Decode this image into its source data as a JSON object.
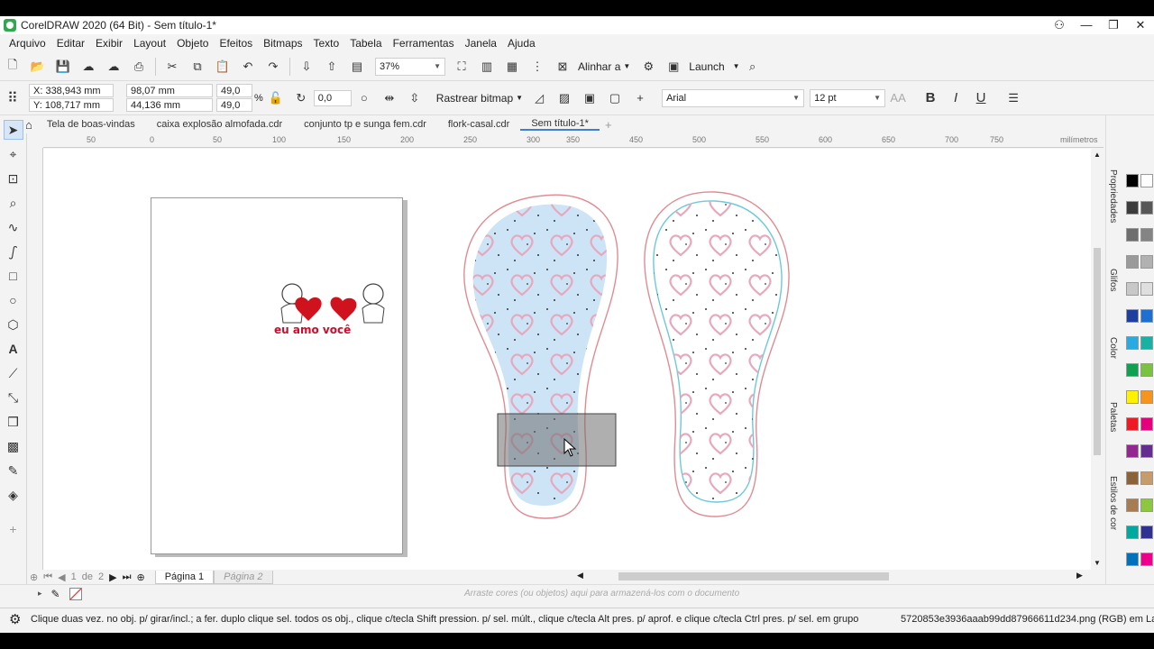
{
  "window": {
    "title": "CorelDRAW 2020 (64 Bit) - Sem título-1*"
  },
  "menu": [
    "Arquivo",
    "Editar",
    "Exibir",
    "Layout",
    "Objeto",
    "Efeitos",
    "Bitmaps",
    "Texto",
    "Tabela",
    "Ferramentas",
    "Janela",
    "Ajuda"
  ],
  "toolbar1": {
    "zoom": "37%",
    "align_label": "Alinhar a",
    "launch_label": "Launch"
  },
  "toolbar2": {
    "x": "X: 338,943 mm",
    "y": "Y: 108,717 mm",
    "w": "98,07 mm",
    "h": "44,136 mm",
    "scale_x": "49,0",
    "scale_y": "49,0",
    "pct": "%",
    "rotation": "0,0",
    "trace_label": "Rastrear bitmap",
    "font": "Arial",
    "size": "12 pt"
  },
  "tabs": [
    "Tela de boas-vindas",
    "caixa explosão almofada.cdr",
    "conjunto tp e sunga fem.cdr",
    "flork-casal.cdr",
    "Sem título-1*"
  ],
  "ruler": {
    "unit": "milímetros",
    "ticks": [
      "50",
      "0",
      "50",
      "100",
      "150",
      "200",
      "250",
      "300",
      "350",
      "400",
      "450",
      "500",
      "550",
      "600",
      "650",
      "700",
      "750"
    ]
  },
  "page_nav": {
    "current": "1",
    "of": "de",
    "total": "2",
    "page1": "Página 1",
    "page2": "Página 2"
  },
  "logo_text": "eu amo você",
  "color_tray_hint": "Arraste cores (ou objetos) aqui para armazená-los com o documento",
  "status": {
    "message": "Clique duas vez. no obj. p/ girar/incl.; a fer. duplo clique sel. todos os obj., clique c/tecla Shift pression. p/ sel. múlt., clique c/tecla Alt pres. p/ aprof. e clique c/tecla Ctrl pres. p/ sel. em grupo",
    "file": "5720853e3936aaab99dd87966611d234.png (RGB) em Lay"
  },
  "dockers": [
    "Propriedades",
    "Glifos",
    "Color",
    "Paletas",
    "Estilos de cor"
  ],
  "palette": [
    "#000000",
    "#ffffff",
    "#3c3c3c",
    "#575757",
    "#6e6e6e",
    "#848484",
    "#9a9a9a",
    "#b1b1b1",
    "#c8c8c8",
    "#dfdfdf",
    "#1f3f9f",
    "#1d6fd1",
    "#29abe2",
    "#19b1a3",
    "#0fa14f",
    "#7bc142",
    "#fff200",
    "#f7941d",
    "#ed1c24",
    "#e5007e",
    "#92278f",
    "#662d91",
    "#8c6239",
    "#c69c6d",
    "#a67c52",
    "#8dc63f",
    "#00a99d",
    "#2e3192",
    "#0072bc",
    "#ec008c"
  ],
  "colors": {
    "accent": "#3c7fd4",
    "sole_fill": "#cde4f7",
    "heart": "#e7a8bd",
    "outline": "#e08b94",
    "inner": "#6cc9d8"
  }
}
